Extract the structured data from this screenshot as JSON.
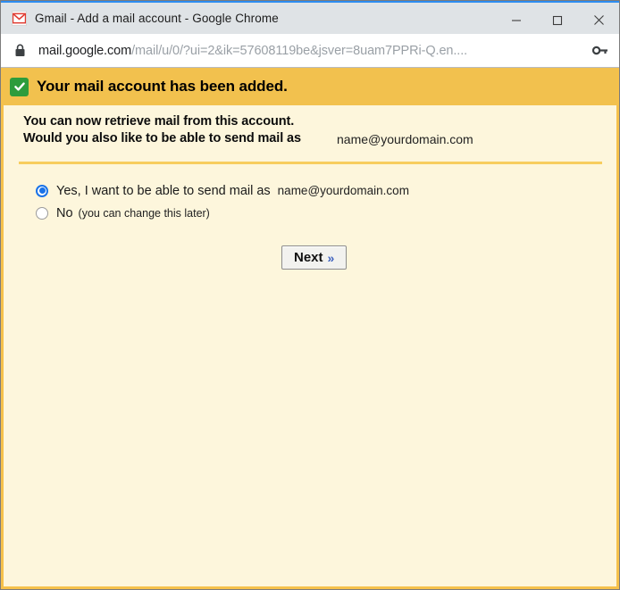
{
  "window": {
    "title": "Gmail - Add a mail account - Google Chrome",
    "app_icon": "gmail-icon",
    "controls": {
      "minimize": "minimize-icon",
      "maximize": "maximize-icon",
      "close": "close-icon"
    }
  },
  "address_bar": {
    "lock_icon": "lock-icon",
    "url_host": "mail.google.com",
    "url_path": "/mail/u/0/?ui=2&ik=57608119be&jsver=8uam7PPRi-Q.en....",
    "key_icon": "key-icon"
  },
  "banner": {
    "icon": "green-check-icon",
    "title": "Your mail account has been added.",
    "background": "#f2c14e"
  },
  "body": {
    "line1": "You can now retrieve mail from this account.",
    "line2": "Would you also like to be able to send mail as",
    "line2_email": "name@yourdomain.com"
  },
  "options": [
    {
      "id": "yes",
      "selected": true,
      "label": "Yes, I want to be able to send mail as",
      "email": "name@yourdomain.com",
      "hint": ""
    },
    {
      "id": "no",
      "selected": false,
      "label": "No",
      "email": "",
      "hint": "(you can change this later)"
    }
  ],
  "next_button": {
    "label": "Next",
    "chevron": "»"
  },
  "colors": {
    "banner": "#f2c14e",
    "page_background": "#fdf6dc",
    "border": "#f5c14b",
    "accent_radio": "#1a73e8",
    "check_green": "#2e9c3c"
  }
}
